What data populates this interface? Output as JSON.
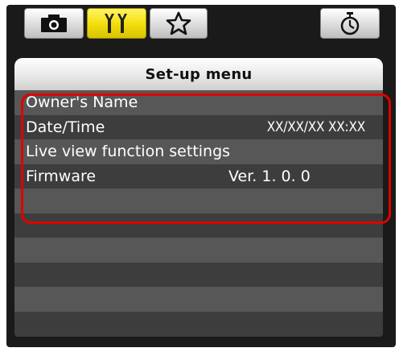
{
  "tabs": [
    {
      "name": "camera",
      "icon": "camera-icon",
      "active": false
    },
    {
      "name": "setup",
      "icon": "wrench-icon",
      "active": true
    },
    {
      "name": "mymenu",
      "icon": "star-icon",
      "active": false
    },
    {
      "name": "timer",
      "icon": "timer-icon",
      "active": false
    }
  ],
  "menu": {
    "title": "Set-up menu",
    "items": [
      {
        "label": "Owner's Name",
        "value": ""
      },
      {
        "label": "Date/Time",
        "value": "XX/XX/XX XX:XX"
      },
      {
        "label": "Live view function settings",
        "value": ""
      },
      {
        "label": "Firmware",
        "value": "Ver. 1. 0. 0"
      }
    ]
  },
  "colors": {
    "active_tab": "#f4e010",
    "highlight": "#e00000",
    "background": "#1a1a1a"
  }
}
